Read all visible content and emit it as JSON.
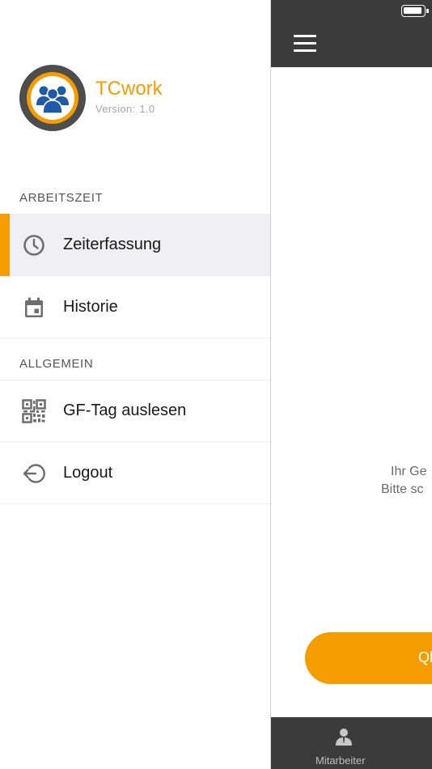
{
  "colors": {
    "accent": "#f59c00",
    "dark_bar": "#3b3b3b",
    "active_row": "#efeff4"
  },
  "drawer": {
    "app_name": "TCwork",
    "version_label": "Version:",
    "version_value": "1.0",
    "avatar_icon": "team-icon",
    "sections": [
      {
        "title": "ARBEITSZEIT"
      },
      {
        "title": "ALLGEMEIN"
      }
    ],
    "items": [
      {
        "label": "Zeiterfassung",
        "icon": "clock-icon",
        "active": true
      },
      {
        "label": "Historie",
        "icon": "calendar-icon",
        "active": false
      },
      {
        "label": "GF-Tag auslesen",
        "icon": "qr-code-icon",
        "active": false
      },
      {
        "label": "Logout",
        "icon": "logout-icon",
        "active": false
      }
    ]
  },
  "main": {
    "menu_icon": "hamburger-menu-icon",
    "battery_icon": "battery-icon",
    "message_line1": "Ihr Ge",
    "message_line2": "Bitte sc",
    "qr_button_label": "Ql",
    "tab": {
      "label": "Mitarbeiter",
      "icon": "person-icon"
    }
  }
}
